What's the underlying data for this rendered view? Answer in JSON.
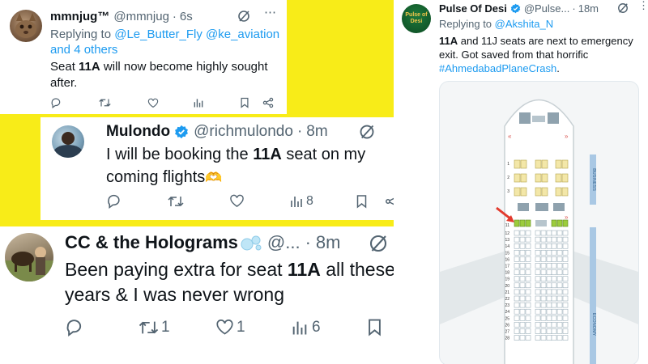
{
  "tweet1": {
    "name": "mmnjug™",
    "handle": "@mmnjug",
    "sep": "·",
    "time": "6s",
    "replying_prefix": "Replying to ",
    "replying_user1": "@Le_Butter_Fly",
    "replying_user2": "@ke_aviation",
    "replying_rest": "and 4 others",
    "text_before": "Seat ",
    "text_bold": "11A",
    "text_after": " will now become highly sought after."
  },
  "tweet2": {
    "name": "Mulondo",
    "handle": "@richmulondo",
    "sep": "·",
    "time": "8m",
    "text_before": "I will be booking the ",
    "text_bold": "11A",
    "text_after": " seat on my coming flights",
    "emoji": "🫶",
    "views": "8"
  },
  "tweet3": {
    "name": "CC & the Holograms",
    "handle": "@...",
    "sep": "·",
    "time": "8m",
    "text_before": "Been paying extra for seat ",
    "text_bold": "11A",
    "text_after": " all these years & I was never wrong",
    "retweets": "1",
    "likes": "1",
    "views": "6"
  },
  "tweet4": {
    "name": "Pulse Of Desi",
    "handle": "@Pulse...",
    "sep": "·",
    "time": "18m",
    "avatar_text": "Pulse of Desi",
    "replying_prefix": "Replying to ",
    "replying_user": "@Akshita_N",
    "text_bold1": "11A",
    "text_mid": " and 11J seats are next to emergency exit. Got saved from that horrific ",
    "hashtag": "#AhmedabadPlaneCrash",
    "text_end": ".",
    "seatmap": {
      "section_business": "BUSINESS",
      "section_economy": "ECONOMY",
      "rows": [
        "1",
        "2",
        "3",
        "11",
        "12",
        "13",
        "14",
        "15",
        "16",
        "17",
        "18",
        "19",
        "20",
        "21",
        "22",
        "23",
        "24",
        "25",
        "26",
        "27",
        "28"
      ]
    }
  },
  "colors": {
    "background": "#f8ec18",
    "accent": "#1d9bf0",
    "text": "#0f1419",
    "muted": "#536471",
    "highlight_seat": "#9ccc3c"
  }
}
